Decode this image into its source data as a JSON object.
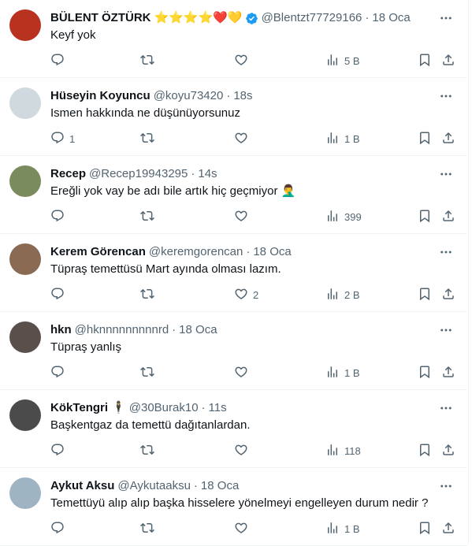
{
  "tweets": [
    {
      "name": "BÜLENT ÖZTÜRK",
      "emojis": "⭐⭐⭐⭐❤️💛",
      "verified": true,
      "handle": "@Blentzt77729166",
      "time": "18 Oca",
      "text": "Keyf yok",
      "replies": "",
      "likes": "",
      "views": "5 B",
      "avatar_color": "#b8321f"
    },
    {
      "name": "Hüseyin Koyuncu",
      "emojis": "",
      "verified": false,
      "handle": "@koyu73420",
      "time": "18s",
      "text": "Ismen hakkında ne düşünüyorsunuz",
      "replies": "1",
      "likes": "",
      "views": "1 B",
      "avatar_color": "#cfd9de"
    },
    {
      "name": "Recep",
      "emojis": "",
      "verified": false,
      "handle": "@Recep19943295",
      "time": "14s",
      "text": "Ereğli yok vay be adı bile artık hiç geçmiyor  🤦‍♂️",
      "replies": "",
      "likes": "",
      "views": "399",
      "avatar_color": "#7a8b5e"
    },
    {
      "name": "Kerem Görencan",
      "emojis": "",
      "verified": false,
      "handle": "@keremgorencan",
      "time": "18 Oca",
      "text": "Tüpraş temettüsü Mart ayında olması lazım.",
      "replies": "",
      "likes": "2",
      "views": "2 B",
      "avatar_color": "#8a6a52"
    },
    {
      "name": "hkn",
      "emojis": "",
      "verified": false,
      "handle": "@hknnnnnnnnnrd",
      "time": "18 Oca",
      "text": "Tüpraş yanlış",
      "replies": "",
      "likes": "",
      "views": "1 B",
      "avatar_color": "#5a4f4a"
    },
    {
      "name": "KökTengri",
      "emojis": "🕴",
      "verified": false,
      "handle": "@30Burak10",
      "time": "11s",
      "text": "Başkentgaz da temettü dağıtanlardan.",
      "replies": "",
      "likes": "",
      "views": "118",
      "avatar_color": "#4b4b4b"
    },
    {
      "name": "Aykut Aksu",
      "emojis": "",
      "verified": false,
      "handle": "@Aykutaaksu",
      "time": "18 Oca",
      "text": "Temettüyü alıp alıp başka hisselere yönelmeyi engelleyen durum nedir ?",
      "replies": "",
      "likes": "",
      "views": "1 B",
      "avatar_color": "#9fb4c2"
    }
  ]
}
